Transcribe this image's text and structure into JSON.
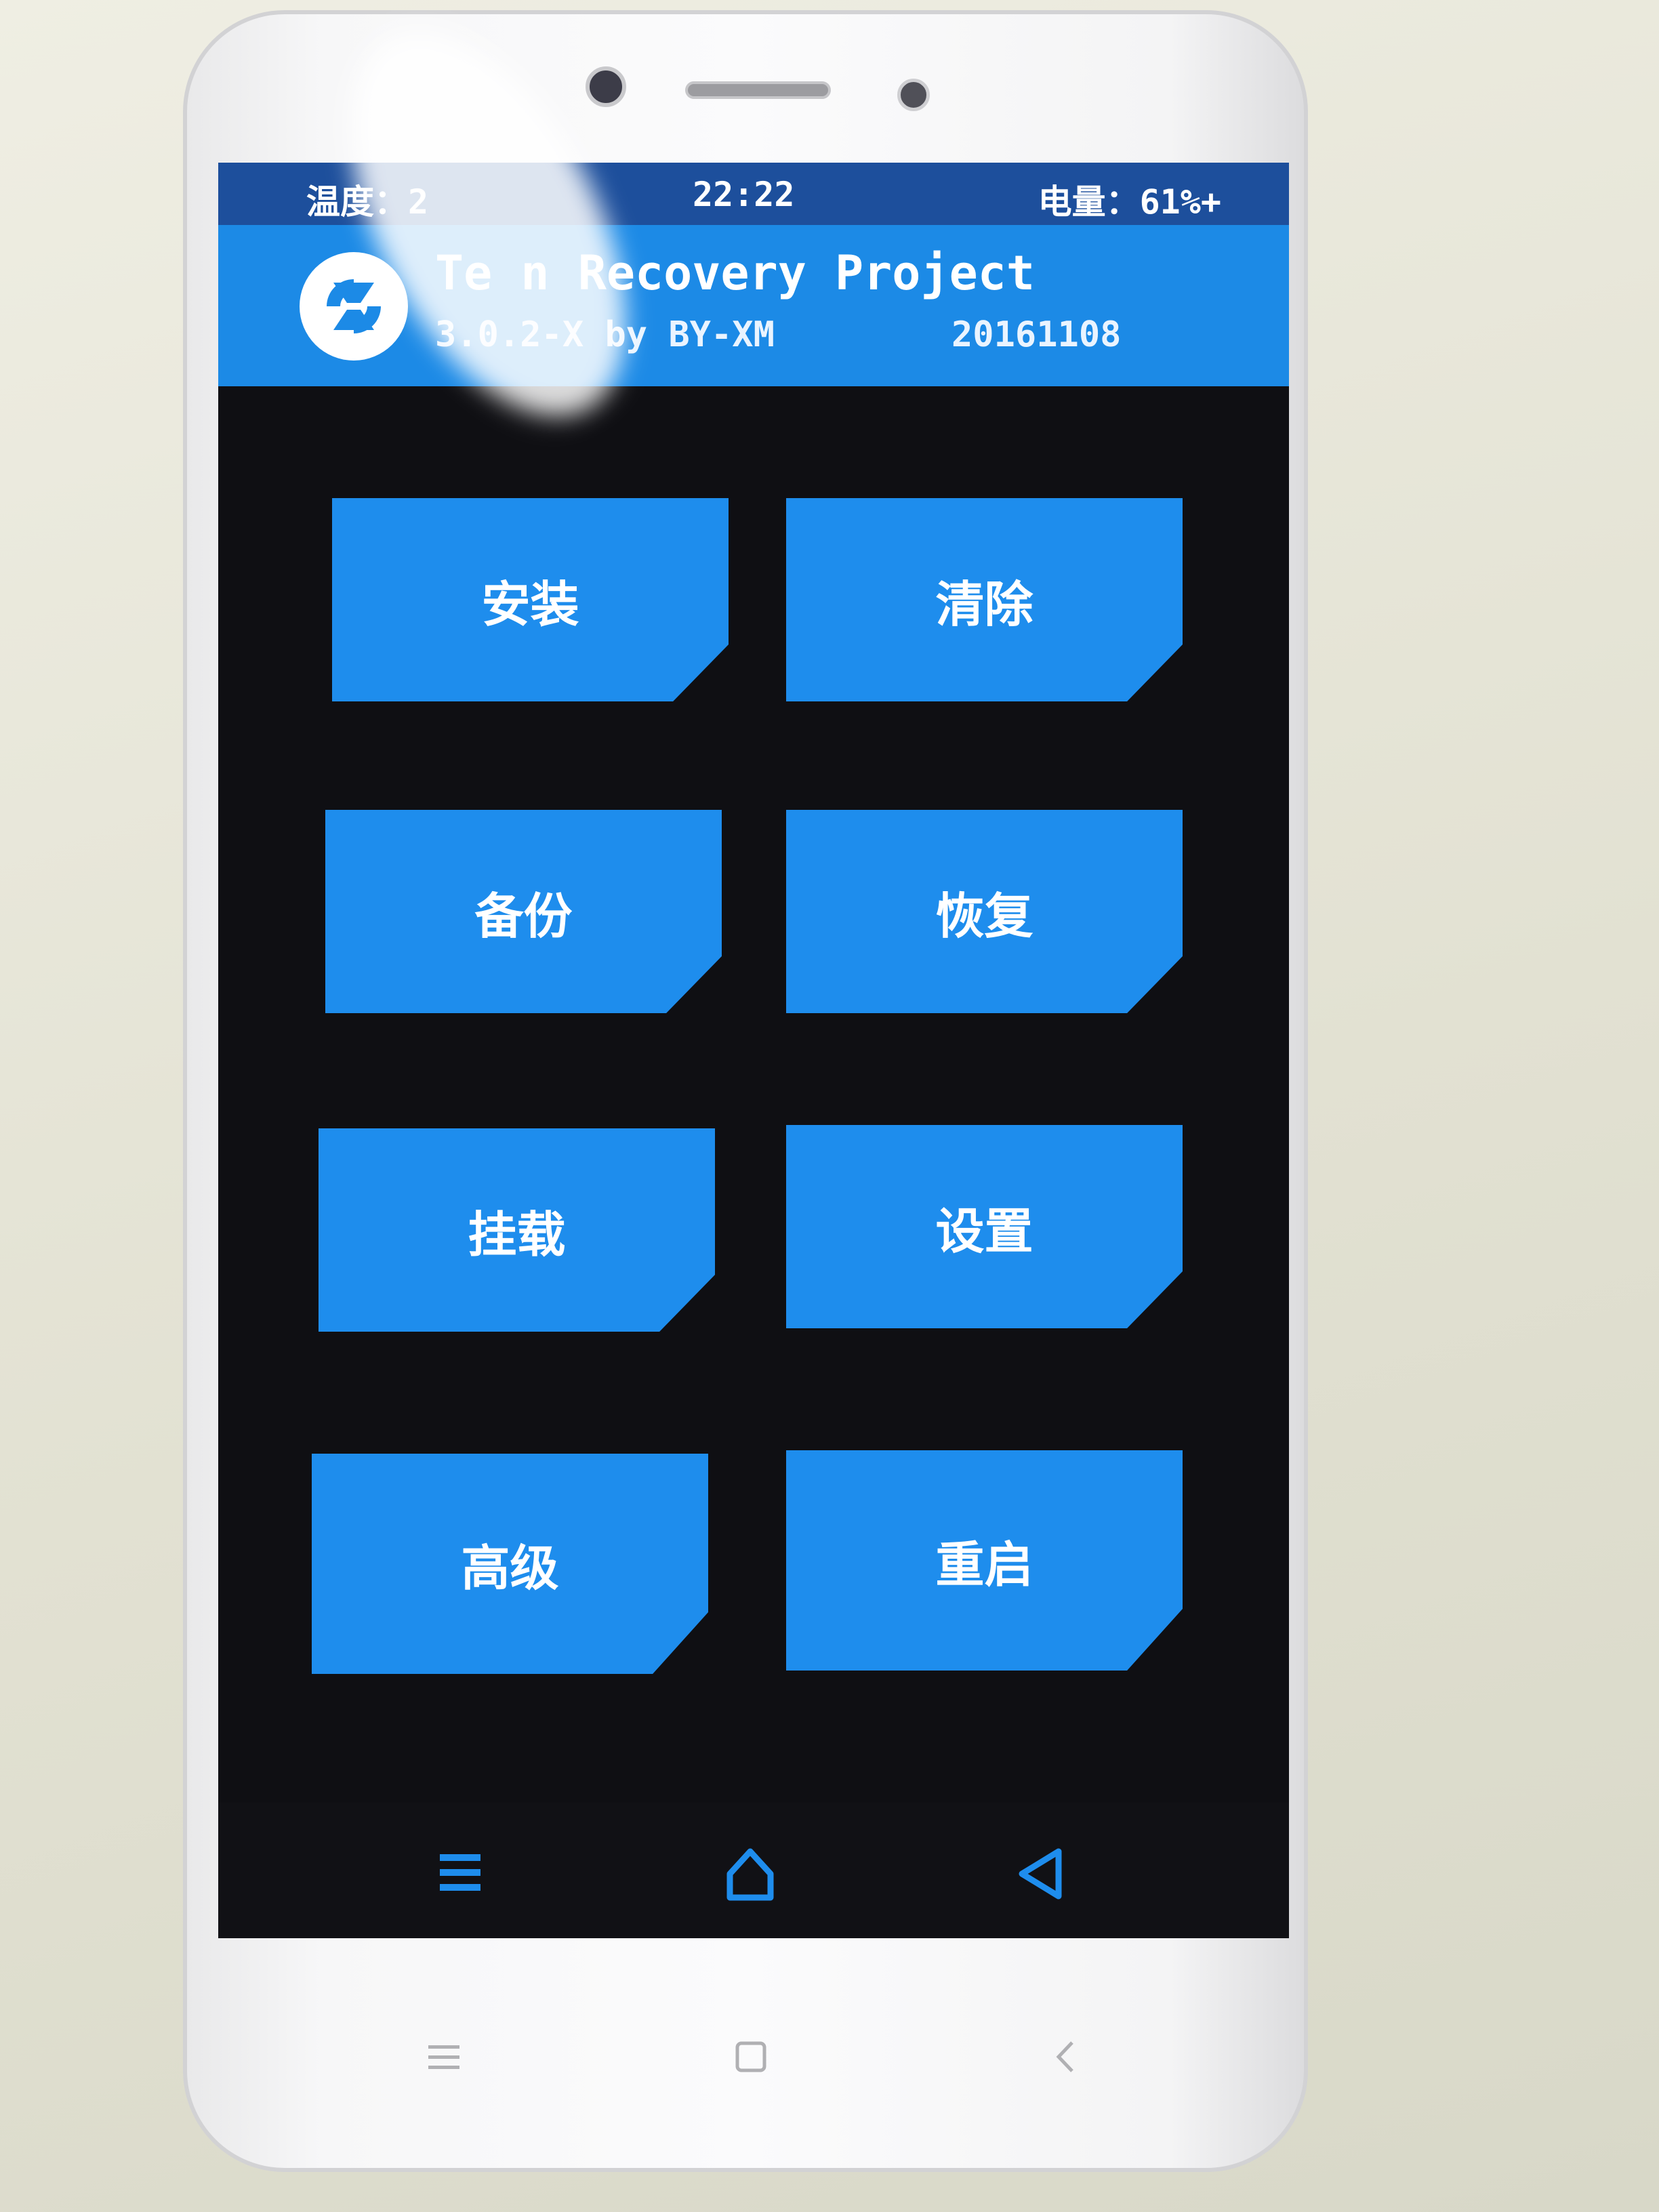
{
  "status_bar": {
    "temperature": "温度：2",
    "time": "22:22",
    "battery": "电量：61%+"
  },
  "header": {
    "title": "Te   n Recovery Project",
    "version": "3.0.2-X by BY-XM",
    "build": "20161108",
    "logo_icon": "twrp-logo-icon"
  },
  "main_menu": {
    "buttons": [
      {
        "label": "安装"
      },
      {
        "label": "清除"
      },
      {
        "label": "备份"
      },
      {
        "label": "恢复"
      },
      {
        "label": "挂载"
      },
      {
        "label": "设置"
      },
      {
        "label": "高级"
      },
      {
        "label": "重启"
      }
    ]
  },
  "nav_bar": {
    "icons": [
      "menu-icon",
      "home-icon",
      "back-icon"
    ],
    "accent_color": "#1e8ded"
  },
  "hardware_keys": {
    "icons": [
      "menu-key-icon",
      "home-key-icon",
      "back-key-icon"
    ]
  },
  "colors": {
    "status_bar": "#1d4f9c",
    "title_bar": "#1c8ae6",
    "tile": "#1e8ded",
    "screen_bg": "#0f0f13"
  }
}
